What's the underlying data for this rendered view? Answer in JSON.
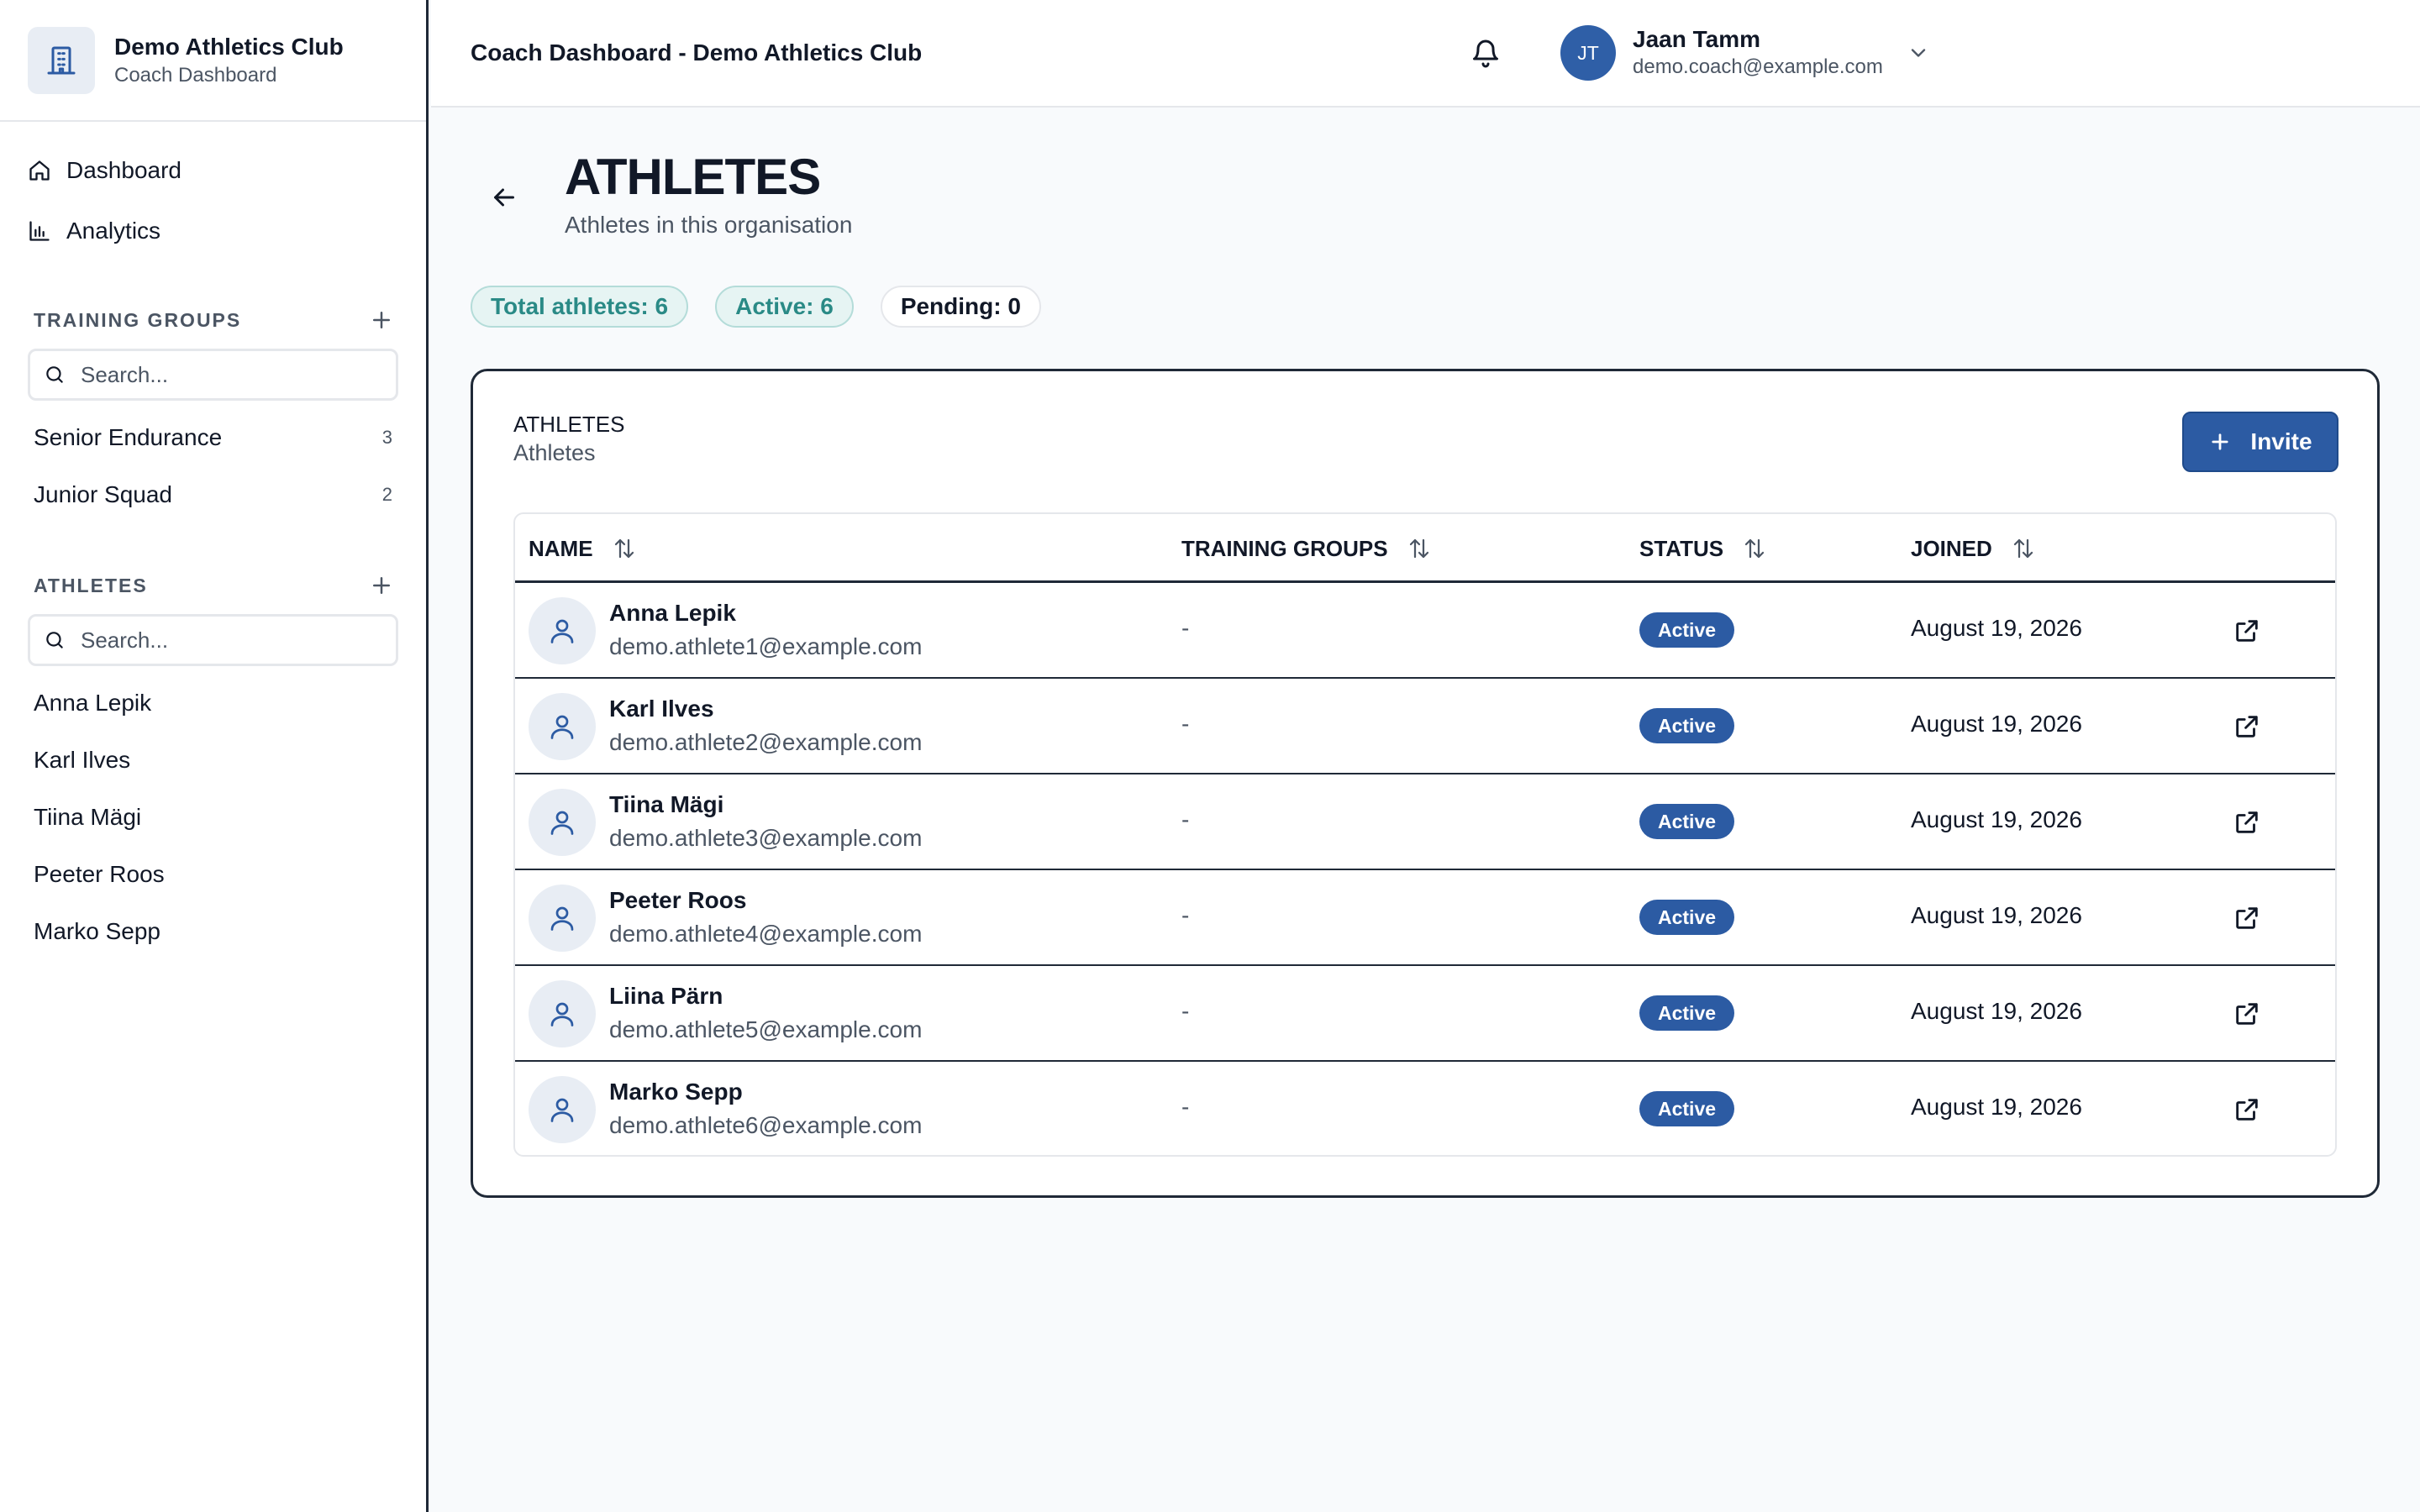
{
  "brand": {
    "name": "Demo Athletics Club",
    "subtitle": "Coach Dashboard",
    "icon": "building-icon"
  },
  "nav": [
    {
      "label": "Dashboard",
      "icon": "home-icon"
    },
    {
      "label": "Analytics",
      "icon": "bar-chart-icon"
    }
  ],
  "training_groups": {
    "heading": "TRAINING GROUPS",
    "search_placeholder": "Search...",
    "items": [
      {
        "label": "Senior Endurance",
        "count": "3"
      },
      {
        "label": "Junior Squad",
        "count": "2"
      }
    ]
  },
  "athletes_section": {
    "heading": "ATHLETES",
    "search_placeholder": "Search...",
    "items": [
      {
        "label": "Anna Lepik"
      },
      {
        "label": "Karl Ilves"
      },
      {
        "label": "Tiina Mägi"
      },
      {
        "label": "Peeter Roos"
      },
      {
        "label": "Marko Sepp"
      }
    ]
  },
  "topbar": {
    "title": "Coach Dashboard - Demo Athletics Club",
    "user": {
      "initials": "JT",
      "name": "Jaan Tamm",
      "email": "demo.coach@example.com"
    }
  },
  "page": {
    "title": "ATHLETES",
    "subtitle": "Athletes in this organisation"
  },
  "stats": {
    "total": "Total athletes: 6",
    "active": "Active: 6",
    "pending": "Pending: 0"
  },
  "card": {
    "title": "ATHLETES",
    "subtitle": "Athletes",
    "invite_label": "Invite",
    "columns": {
      "name": "NAME",
      "groups": "TRAINING GROUPS",
      "status": "STATUS",
      "joined": "JOINED"
    },
    "rows": [
      {
        "name": "Anna Lepik",
        "email": "demo.athlete1@example.com",
        "groups": "-",
        "status": "Active",
        "joined": "August 19, 2026"
      },
      {
        "name": "Karl Ilves",
        "email": "demo.athlete2@example.com",
        "groups": "-",
        "status": "Active",
        "joined": "August 19, 2026"
      },
      {
        "name": "Tiina Mägi",
        "email": "demo.athlete3@example.com",
        "groups": "-",
        "status": "Active",
        "joined": "August 19, 2026"
      },
      {
        "name": "Peeter Roos",
        "email": "demo.athlete4@example.com",
        "groups": "-",
        "status": "Active",
        "joined": "August 19, 2026"
      },
      {
        "name": "Liina Pärn",
        "email": "demo.athlete5@example.com",
        "groups": "-",
        "status": "Active",
        "joined": "August 19, 2026"
      },
      {
        "name": "Marko Sepp",
        "email": "demo.athlete6@example.com",
        "groups": "-",
        "status": "Active",
        "joined": "August 19, 2026"
      }
    ]
  },
  "colors": {
    "accent": "#2c5ba3",
    "teal": "#2a8a86",
    "border": "#1f2937"
  }
}
